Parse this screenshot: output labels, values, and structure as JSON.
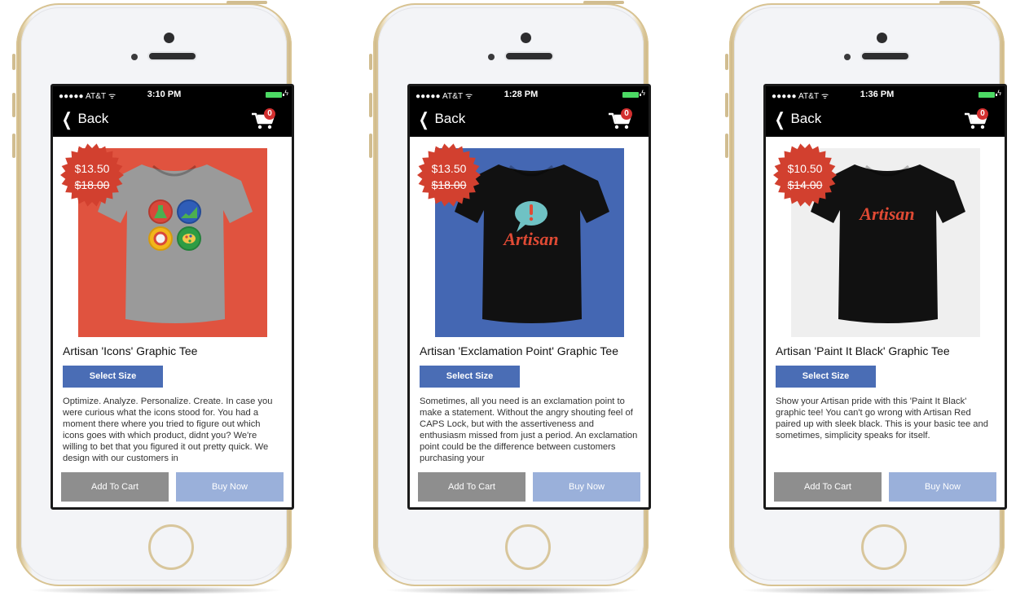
{
  "phones": [
    {
      "status": {
        "carrier": "●●●●● AT&T ᯤ",
        "time": "3:10 PM",
        "bolt": "ϟ"
      },
      "nav": {
        "back_label": "Back",
        "cart_count": "0"
      },
      "product": {
        "sale_price": "$13.50",
        "original_price": "$18.00",
        "title": "Artisan 'Icons' Graphic Tee",
        "image_bg": "#e0533f",
        "shirt_color": "#9a9a9a",
        "graphic": "icons",
        "select_size_label": "Select Size",
        "description": "Optimize. Analyze. Personalize. Create. In case you were curious what the icons stood for. You had a moment there where you tried to figure out which icons goes with which product, didnt you? We're willing to bet that you figured it out pretty quick. We design with our customers in",
        "add_to_cart_label": "Add To Cart",
        "buy_now_label": "Buy Now"
      }
    },
    {
      "status": {
        "carrier": "●●●●● AT&T ᯤ",
        "time": "1:28 PM",
        "bolt": "ϟ"
      },
      "nav": {
        "back_label": "Back",
        "cart_count": "0"
      },
      "product": {
        "sale_price": "$13.50",
        "original_price": "$18.00",
        "title": "Artisan 'Exclamation Point' Graphic Tee",
        "image_bg": "#4467b3",
        "shirt_color": "#111111",
        "graphic": "exclamation",
        "graphic_text": "Artisan",
        "select_size_label": "Select Size",
        "description": "Sometimes, all you need is an exclamation point to make a statement. Without the angry shouting feel of CAPS Lock, but with the assertiveness and enthusiasm missed from just a period. An exclamation point could be the difference between customers purchasing your",
        "add_to_cart_label": "Add To Cart",
        "buy_now_label": "Buy Now"
      }
    },
    {
      "status": {
        "carrier": "●●●●● AT&T ᯤ",
        "time": "1:36 PM",
        "bolt": "ϟ"
      },
      "nav": {
        "back_label": "Back",
        "cart_count": "0"
      },
      "product": {
        "sale_price": "$10.50",
        "original_price": "$14.00",
        "title": "Artisan 'Paint It Black' Graphic Tee",
        "image_bg": "#efefef",
        "shirt_color": "#111111",
        "graphic": "wordmark",
        "graphic_text": "Artisan",
        "select_size_label": "Select Size",
        "description": "Show your Artisan pride with this 'Paint It Black' graphic tee! You can't go wrong with Artisan Red paired up with sleek black. This is your basic tee and sometimes, simplicity speaks for itself.",
        "add_to_cart_label": "Add To Cart",
        "buy_now_label": "Buy Now"
      }
    }
  ],
  "colors": {
    "burst": "#d2402f",
    "select_size": "#4a6db5",
    "add_to_cart": "#8e8e8e",
    "buy_now": "#9ab0da",
    "artisan_red": "#e04a34"
  }
}
